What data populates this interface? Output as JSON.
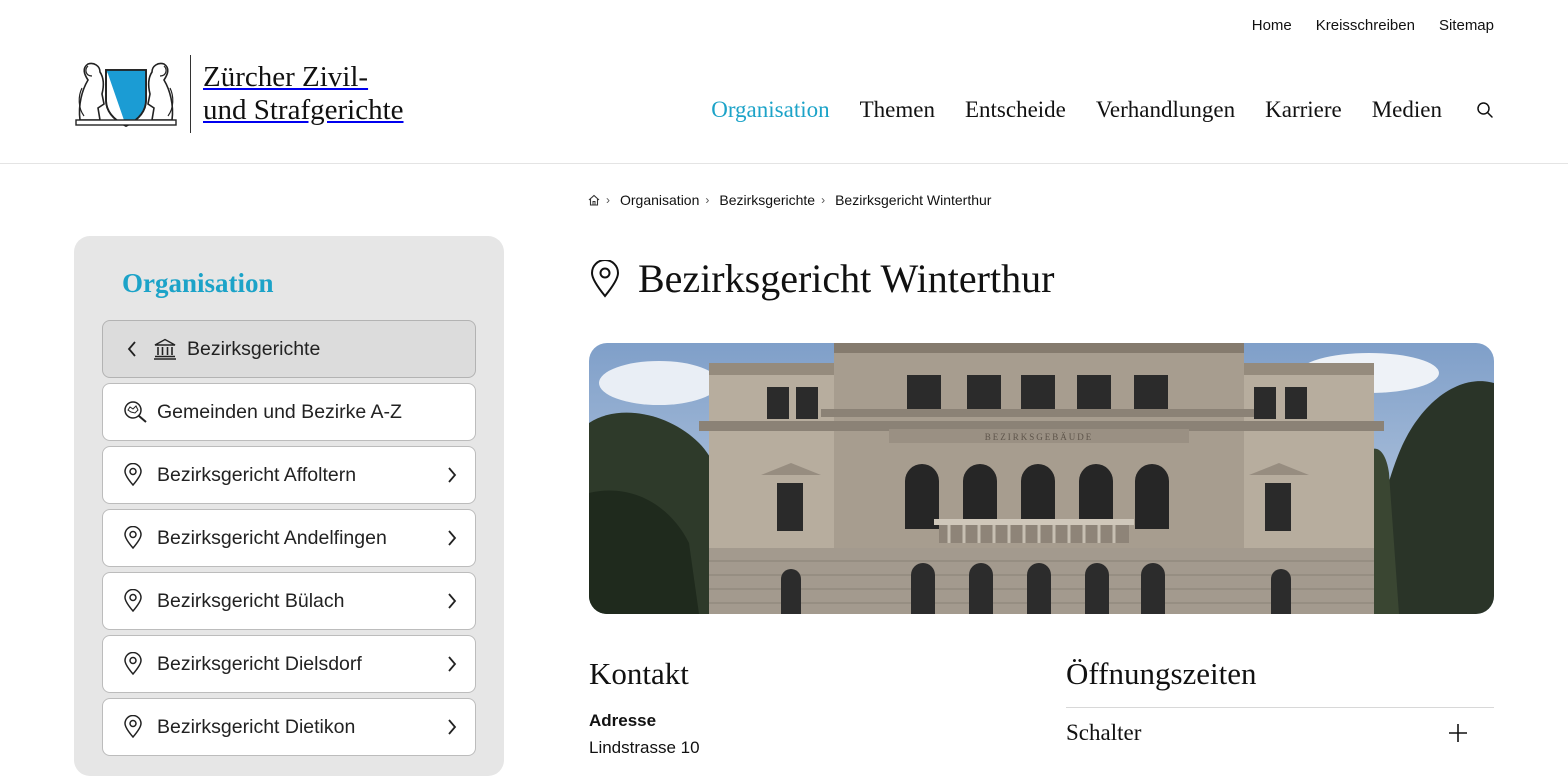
{
  "utility_nav": [
    "Home",
    "Kreisschreiben",
    "Sitemap"
  ],
  "logo": {
    "line1": "Zürcher Zivil-",
    "line2": "und Strafgerichte"
  },
  "main_nav": {
    "items": [
      "Organisation",
      "Themen",
      "Entscheide",
      "Verhandlungen",
      "Karriere",
      "Medien"
    ],
    "active": "Organisation",
    "accent_color": "#1ca3c8"
  },
  "breadcrumb": [
    "Organisation",
    "Bezirksgerichte",
    "Bezirksgericht Winterthur"
  ],
  "sidebar": {
    "title": "Organisation",
    "back": {
      "label": "Bezirksgerichte",
      "icon": "courthouse-icon"
    },
    "items": [
      {
        "label": "Gemeinden und Bezirke A-Z",
        "icon": "search-map-icon",
        "has_arrow": false
      },
      {
        "label": "Bezirksgericht Affoltern",
        "icon": "location-pin-icon",
        "has_arrow": true
      },
      {
        "label": "Bezirksgericht Andelfingen",
        "icon": "location-pin-icon",
        "has_arrow": true
      },
      {
        "label": "Bezirksgericht Bülach",
        "icon": "location-pin-icon",
        "has_arrow": true
      },
      {
        "label": "Bezirksgericht Dielsdorf",
        "icon": "location-pin-icon",
        "has_arrow": true
      },
      {
        "label": "Bezirksgericht Dietikon",
        "icon": "location-pin-icon",
        "has_arrow": true
      }
    ]
  },
  "page": {
    "title": "Bezirksgericht Winterthur",
    "building_inscription": "BEZIRKSGEBÄUDE",
    "contact_heading": "Kontakt",
    "address_label": "Adresse",
    "address_line": "Lindstrasse 10",
    "hours_heading": "Öffnungszeiten",
    "hours_first_item": "Schalter"
  }
}
